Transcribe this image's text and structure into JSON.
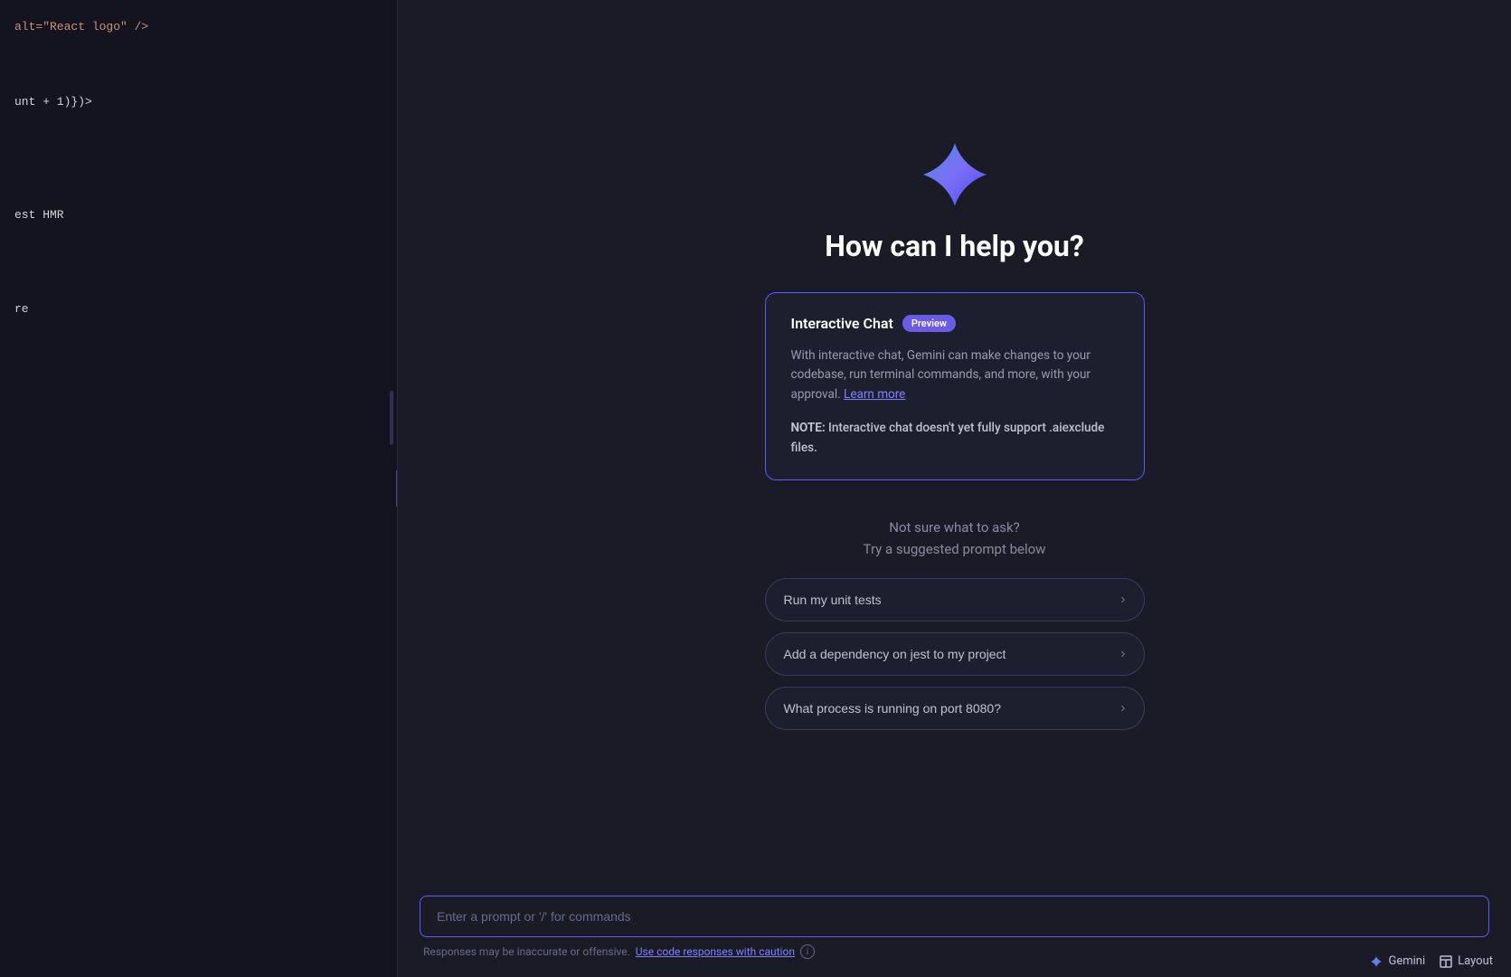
{
  "code_panel": {
    "lines": [
      {
        "text": "alt=\"React logo\" />",
        "color": "orange"
      },
      {
        "text": "",
        "color": "white"
      },
      {
        "text": "",
        "color": "white"
      },
      {
        "text": "",
        "color": "white"
      },
      {
        "text": "",
        "color": "white"
      },
      {
        "text": "unt + 1)})>",
        "color": "white"
      },
      {
        "text": "",
        "color": "white"
      },
      {
        "text": "",
        "color": "white"
      },
      {
        "text": "",
        "color": "white"
      },
      {
        "text": "",
        "color": "white"
      },
      {
        "text": "",
        "color": "white"
      },
      {
        "text": "est HMR",
        "color": "white"
      },
      {
        "text": "",
        "color": "white"
      },
      {
        "text": "",
        "color": "white"
      },
      {
        "text": "",
        "color": "white"
      },
      {
        "text": "",
        "color": "white"
      },
      {
        "text": "",
        "color": "white"
      },
      {
        "text": "re",
        "color": "white"
      },
      {
        "text": "",
        "color": "white"
      },
      {
        "text": "",
        "color": "white"
      },
      {
        "text": "",
        "color": "white"
      },
      {
        "text": "",
        "color": "white"
      },
      {
        "text": "",
        "color": "white"
      },
      {
        "text": "",
        "color": "white"
      }
    ]
  },
  "header": {
    "title": "How can I help you?"
  },
  "card": {
    "title": "Interactive Chat",
    "badge": "Preview",
    "description": "With interactive chat, Gemini can make changes to your codebase, run terminal commands, and more, with your approval.",
    "learn_more": "Learn more",
    "note": "NOTE: Interactive chat doesn't yet fully support .aiexclude files."
  },
  "suggestions": {
    "header_line1": "Not sure what to ask?",
    "header_line2": "Try a suggested prompt below",
    "items": [
      {
        "label": "Run my unit tests",
        "id": "run-unit-tests"
      },
      {
        "label": "Add a dependency on jest to my project",
        "id": "add-jest"
      },
      {
        "label": "What process is running on port 8080?",
        "id": "port-8080"
      }
    ]
  },
  "input": {
    "placeholder": "Enter a prompt or '/' for commands"
  },
  "footer": {
    "warning": "Responses may be inaccurate or offensive.",
    "caution_link": "Use code responses with caution"
  },
  "bottom_bar": {
    "gemini_label": "Gemini",
    "layout_label": "Layout"
  }
}
